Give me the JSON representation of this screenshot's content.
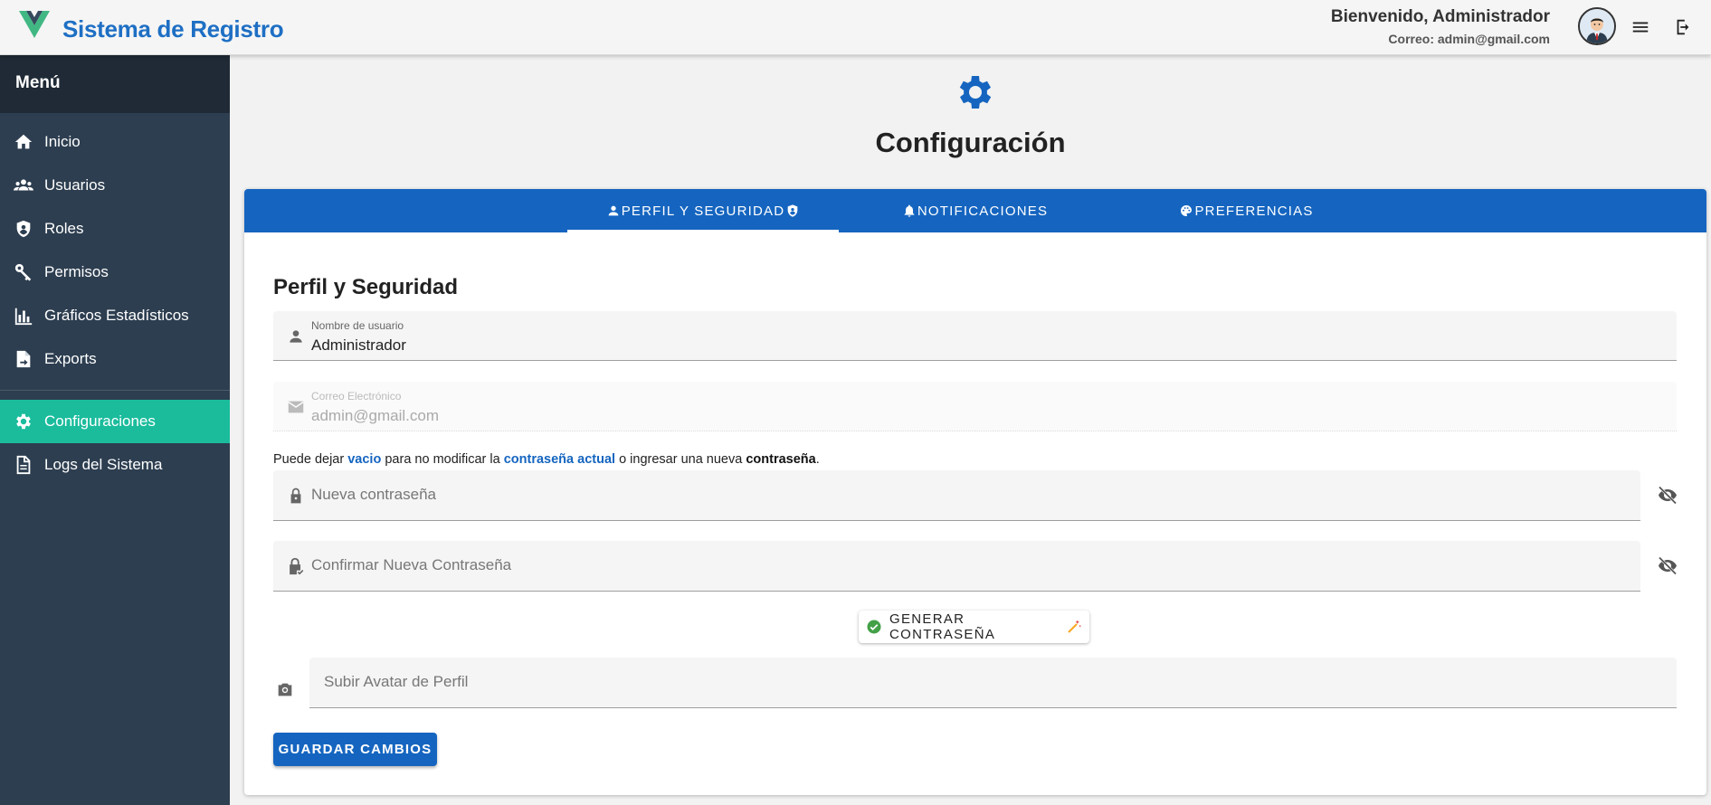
{
  "header": {
    "app_title": "Sistema de Registro",
    "welcome": "Bienvenido, Administrador",
    "email": "Correo: admin@gmail.com",
    "logo_icon": "vue-logo-icon",
    "menu_icon": "hamburger-menu-icon",
    "logout_icon": "logout-icon"
  },
  "sidebar": {
    "title": "Menú",
    "items": [
      {
        "label": "Inicio",
        "icon": "home-icon"
      },
      {
        "label": "Usuarios",
        "icon": "users-icon"
      },
      {
        "label": "Roles",
        "icon": "shield-icon"
      },
      {
        "label": "Permisos",
        "icon": "key-icon"
      },
      {
        "label": "Gráficos Estadísticos",
        "icon": "bar-chart-icon"
      },
      {
        "label": "Exports",
        "icon": "file-export-icon"
      },
      {
        "label": "Configuraciones",
        "icon": "gear-icon",
        "active": true
      },
      {
        "label": "Logs del Sistema",
        "icon": "document-icon"
      }
    ]
  },
  "page": {
    "title": "Configuración",
    "icon": "gear-icon"
  },
  "tabs": [
    {
      "label": "PERFIL Y SEGURIDAD",
      "active": true
    },
    {
      "label": "NOTIFICACIONES",
      "active": false
    },
    {
      "label": "PREFERENCIAS",
      "active": false
    }
  ],
  "form": {
    "section_title": "Perfil y Seguridad",
    "username": {
      "label": "Nombre de usuario",
      "value": "Administrador"
    },
    "email": {
      "label": "Correo Electrónico",
      "value": "admin@gmail.com"
    },
    "hint": {
      "p1": "Puede dejar ",
      "p2": "vacio",
      "p3": " para no modificar la ",
      "p4": "contraseña actual",
      "p5": " o ingresar una nueva ",
      "p6": "contraseña",
      "p7": "."
    },
    "new_password": {
      "placeholder": "Nueva contraseña"
    },
    "confirm_password": {
      "placeholder": "Confirmar Nueva Contraseña"
    },
    "generate_label": "GENERAR CONTRASEÑA",
    "avatar_upload": {
      "placeholder": "Subir Avatar de Perfil"
    },
    "save_label": "GUARDAR CAMBIOS"
  },
  "colors": {
    "brand_blue": "#1565c0",
    "title_blue": "#1e6fc4",
    "sidebar_bg": "#2d3e50",
    "active_green": "#1abc9c",
    "check_green": "#43a047",
    "wand_orange": "#f9a825"
  }
}
